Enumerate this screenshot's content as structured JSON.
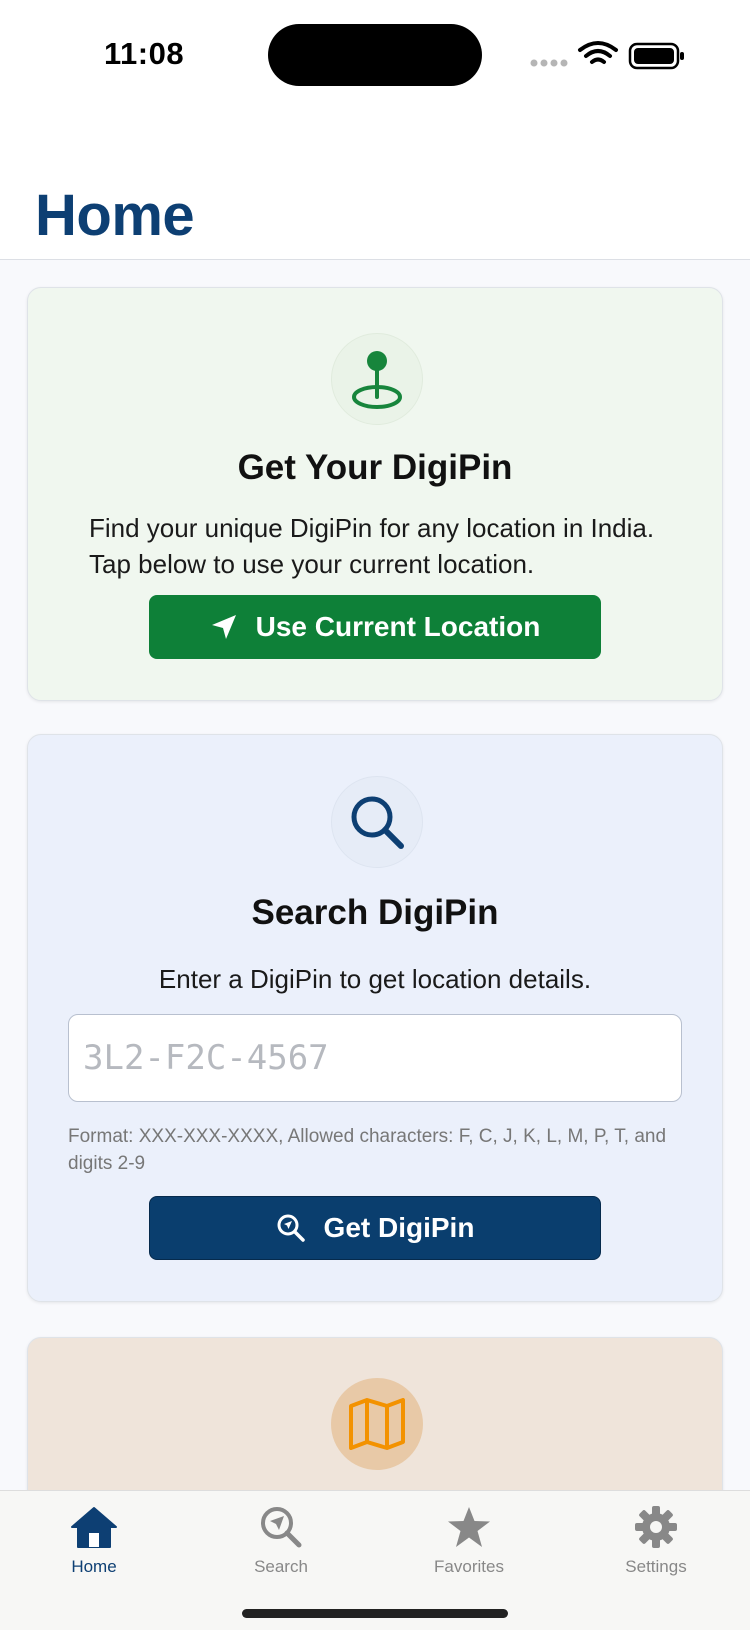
{
  "status_bar": {
    "time": "11:08"
  },
  "header": {
    "title": "Home"
  },
  "location_card": {
    "icon": "location-pin-icon",
    "title": "Get Your DigiPin",
    "description": "Find your unique DigiPin for any location in India. Tap below to use your current location.",
    "button_label": "Use Current Location",
    "button_icon": "navigation-arrow-icon"
  },
  "search_card": {
    "icon": "magnifier-icon",
    "title": "Search DigiPin",
    "description": "Enter a DigiPin to get location details.",
    "input_value": "",
    "input_placeholder": "3L2-F2C-4567",
    "hint": "Format: XXX-XXX-XXXX,  Allowed characters: F, C, J, K, L, M, P, T, and digits 2-9",
    "button_label": "Get DigiPin",
    "button_icon": "search-location-icon"
  },
  "map_card": {
    "icon": "map-icon"
  },
  "tab_bar": {
    "tabs": [
      {
        "label": "Home",
        "icon": "home-icon",
        "active": true
      },
      {
        "label": "Search",
        "icon": "search-compass-icon",
        "active": false
      },
      {
        "label": "Favorites",
        "icon": "star-icon",
        "active": false
      },
      {
        "label": "Settings",
        "icon": "gear-icon",
        "active": false
      }
    ]
  },
  "colors": {
    "primary_navy": "#0d3f73",
    "button_navy": "#0a3e6e",
    "button_green": "#0e8038",
    "card_green_bg": "#f0f7ef",
    "card_blue_bg": "#ebf0fb",
    "card_tan_bg": "#efe4da",
    "map_orange": "#f39200"
  }
}
